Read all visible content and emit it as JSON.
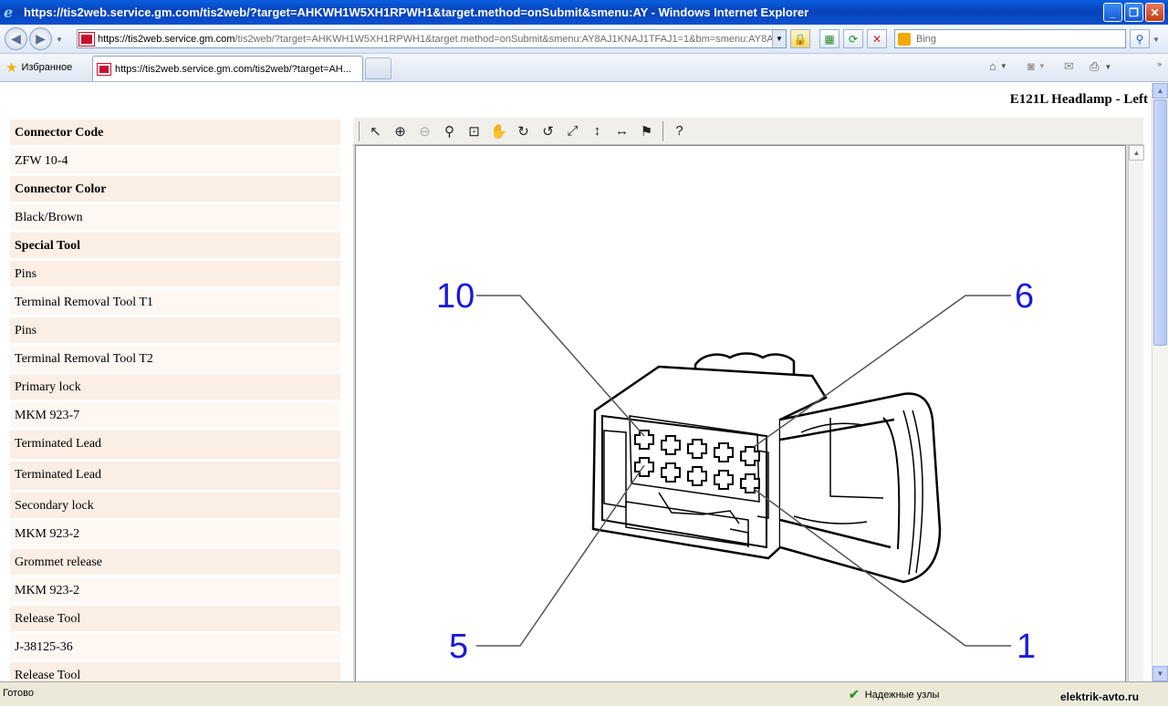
{
  "window": {
    "title": "https://tis2web.service.gm.com/tis2web/?target=AHKWH1W5XH1RPWH1&target.method=onSubmit&smenu:AY - Windows Internet Explorer",
    "minimize": "_",
    "maximize": "❐",
    "close": "✕"
  },
  "address": {
    "proto_host": "https://tis2web.service.gm.com",
    "path": "/tis2web/?target=AHKWH1W5XH1RPWH1&target.method=onSubmit&smenu:AY8AJ1KNAJ1TFAJ1=1&bm=smenu:AY8AJ1"
  },
  "search": {
    "placeholder": "Bing"
  },
  "favorites": {
    "label": "Избранное"
  },
  "tab": {
    "title": "https://tis2web.service.gm.com/tis2web/?target=AH..."
  },
  "page": {
    "title": "E121L Headlamp - Left"
  },
  "list": [
    {
      "text": "Connector Code",
      "kind": "hd"
    },
    {
      "text": "ZFW 10-4",
      "kind": "b"
    },
    {
      "text": "Connector Color",
      "kind": "hd"
    },
    {
      "text": "Black/Brown",
      "kind": "b"
    },
    {
      "text": "Special Tool",
      "kind": "hd"
    },
    {
      "text": "Pins",
      "kind": "a"
    },
    {
      "text": "Terminal Removal Tool T1",
      "kind": "b"
    },
    {
      "text": "Pins",
      "kind": "a"
    },
    {
      "text": "Terminal Removal Tool T2",
      "kind": "b"
    },
    {
      "text": "Primary lock",
      "kind": "a"
    },
    {
      "text": "MKM 923-7",
      "kind": "b"
    },
    {
      "text": "Terminated Lead",
      "kind": "a"
    },
    {
      "text": "Terminated Lead",
      "kind": "a"
    },
    {
      "text": "Secondary lock",
      "kind": "a"
    },
    {
      "text": "MKM 923-2",
      "kind": "b"
    },
    {
      "text": "Grommet release",
      "kind": "a"
    },
    {
      "text": "MKM 923-2",
      "kind": "b"
    },
    {
      "text": "Release Tool",
      "kind": "a"
    },
    {
      "text": "J-38125-36",
      "kind": "b"
    },
    {
      "text": "Release Tool",
      "kind": "a"
    }
  ],
  "diagram": {
    "label_10": "10",
    "label_6": "6",
    "label_5": "5",
    "label_1": "1",
    "label_color": "#1a1adc"
  },
  "status": {
    "text": "Готово",
    "zone": "Надежные узлы",
    "watermark": "elektrik-avto.ru"
  }
}
